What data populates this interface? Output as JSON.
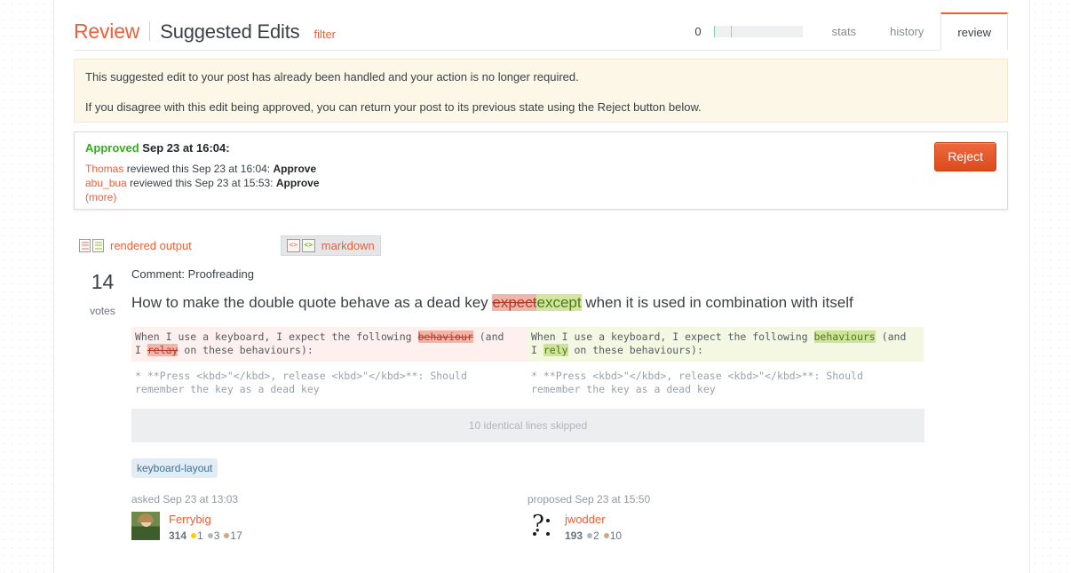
{
  "header": {
    "brand": "Review",
    "section": "Suggested Edits",
    "filter_label": "filter",
    "progress_count": "0",
    "tabs": [
      {
        "label": "stats",
        "active": false
      },
      {
        "label": "history",
        "active": false
      },
      {
        "label": "review",
        "active": true
      }
    ]
  },
  "notice": {
    "line1": "This suggested edit to your post has already been handled and your action is no longer required.",
    "line2": "If you disagree with this edit being approved, you can return your post to its previous state using the Reject button below."
  },
  "approved": {
    "status": "Approved",
    "status_date": "Sep 23 at 16:04:",
    "reviewers": [
      {
        "name": "Thomas",
        "text": "reviewed this Sep 23 at 16:04:",
        "action": "Approve"
      },
      {
        "name": "abu_bua",
        "text": "reviewed this Sep 23 at 15:53:",
        "action": "Approve"
      }
    ],
    "more_label": "(more)",
    "reject_label": "Reject"
  },
  "toggles": {
    "rendered_label": "rendered output",
    "markdown_label": "markdown",
    "selected": "markdown"
  },
  "post": {
    "votes": "14",
    "votes_label": "votes",
    "comment": "Comment: Proofreading",
    "title_before": "How to make the double quote behave as a dead key ",
    "title_deleted": "expect",
    "title_inserted": "except",
    "title_after": " when it is used in combination with itself"
  },
  "diff": {
    "left": {
      "pre1": "When I use a keyboard, I expect the following ",
      "del1": "behaviour",
      "mid1": " (and\nI ",
      "del2": "relay",
      "post1": " on these behaviours):"
    },
    "right": {
      "pre1": "When I use a keyboard, I expect the following ",
      "ins1": "behaviours",
      "mid1": " (and\nI ",
      "ins2": "rely",
      "post1": " on these behaviours):"
    },
    "context": "* **Press <kbd>\"</kbd>, release <kbd>\"</kbd>**: Should\nremember the key as a dead key",
    "skipped_label": "10 identical lines skipped"
  },
  "tags": [
    "keyboard-layout"
  ],
  "users": {
    "asked": {
      "time_label": "asked Sep 23 at 13:03",
      "name": "Ferrybig",
      "reputation": "314",
      "gold": "1",
      "silver": "3",
      "bronze": "17",
      "avatar": "photo-avatar"
    },
    "proposed": {
      "time_label": "proposed Sep 23 at 15:50",
      "name": "jwodder",
      "reputation": "193",
      "silver": "2",
      "bronze": "10",
      "avatar": "question-mark-avatar"
    }
  },
  "colors": {
    "accent": "#e8613c",
    "approved": "#3aab20",
    "reject_button": "#e2562c",
    "tag_bg": "#e1ecf4",
    "tag_fg": "#39739d",
    "diff_del_bg": "#f2b6a8",
    "diff_ins_bg": "#d2e6a0"
  }
}
